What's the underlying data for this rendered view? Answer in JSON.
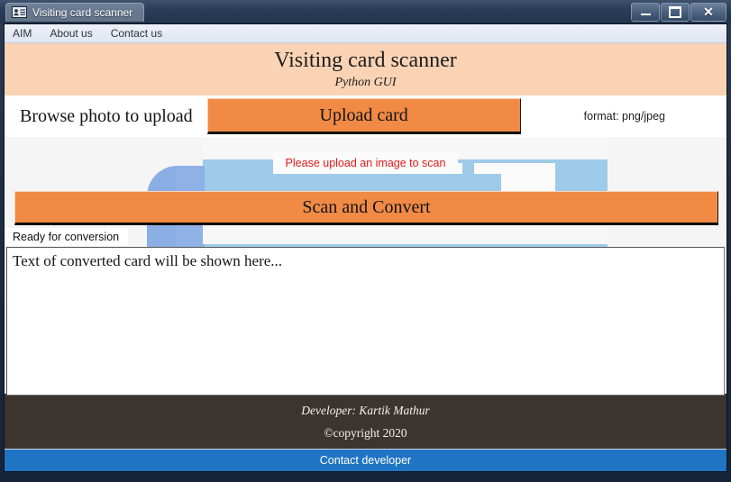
{
  "window": {
    "title": "Visiting card scanner",
    "icon": "contact-card-icon",
    "minimize_label": "Minimize",
    "maximize_label": "Maximize",
    "close_label": "Close"
  },
  "menu": {
    "items": [
      {
        "label": "AIM"
      },
      {
        "label": "About us"
      },
      {
        "label": "Contact us"
      }
    ]
  },
  "banner": {
    "title": "Visiting card scanner",
    "subtitle": "Python GUI",
    "background": "#f9d3b4"
  },
  "upload_row": {
    "label": "Browse photo to upload",
    "button_label": "Upload card",
    "format_hint": "format: png/jpeg",
    "button_color": "#f08a45"
  },
  "preview": {
    "message": "Please upload an image to scan",
    "message_color": "#e01b1b"
  },
  "scan": {
    "button_label": "Scan and Convert",
    "button_color": "#f08a45"
  },
  "status": {
    "text": "Ready for conversion"
  },
  "output": {
    "text": "Text of converted card will be shown here..."
  },
  "footer": {
    "developer": "Developer: Kartik Mathur",
    "copyright": "©copyright 2020",
    "contact_label": "Contact developer",
    "background": "#3b342f",
    "contact_color": "#1f75c4"
  }
}
